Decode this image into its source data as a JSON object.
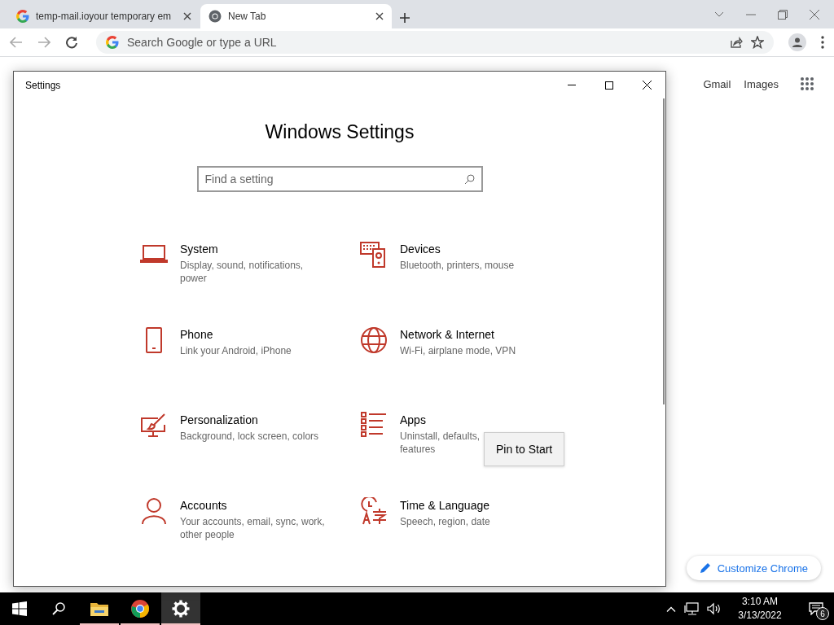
{
  "browser": {
    "tabs": [
      {
        "kind": "google",
        "title": "temp-mail.ioyour temporary em",
        "selected": false
      },
      {
        "kind": "chrome",
        "title": "New Tab",
        "selected": true
      }
    ],
    "omnibox": {
      "placeholder": "Search Google or type a URL"
    },
    "links": [
      "Gmail",
      "Images"
    ],
    "customize_button": "Customize Chrome"
  },
  "settings_window": {
    "title": "Settings",
    "heading": "Windows Settings",
    "search": {
      "placeholder": "Find a setting"
    },
    "categories": [
      {
        "kind": "system",
        "name": "System",
        "description": "Display, sound, notifications, power"
      },
      {
        "kind": "devices",
        "name": "Devices",
        "description": "Bluetooth, printers, mouse"
      },
      {
        "kind": "phone",
        "name": "Phone",
        "description": "Link your Android, iPhone"
      },
      {
        "kind": "network",
        "name": "Network & Internet",
        "description": "Wi-Fi, airplane mode, VPN"
      },
      {
        "kind": "personalization",
        "name": "Personalization",
        "description": "Background, lock screen, colors"
      },
      {
        "kind": "apps",
        "name": "Apps",
        "description": "Uninstall, defaults,\nfeatures"
      },
      {
        "kind": "accounts",
        "name": "Accounts",
        "description": "Your accounts, email, sync, work, other people"
      },
      {
        "kind": "time",
        "name": "Time & Language",
        "description": "Speech, region, date"
      }
    ],
    "context_menu": {
      "items": [
        "Pin to Start"
      ]
    }
  },
  "taskbar": {
    "apps": [
      {
        "kind": "explorer",
        "running": true,
        "selected": false
      },
      {
        "kind": "chrome",
        "running": true,
        "selected": false
      },
      {
        "kind": "settings",
        "running": true,
        "selected": true
      }
    ],
    "clock": {
      "time": "3:10 AM",
      "date": "3/13/2022"
    },
    "notification_count": "6"
  }
}
